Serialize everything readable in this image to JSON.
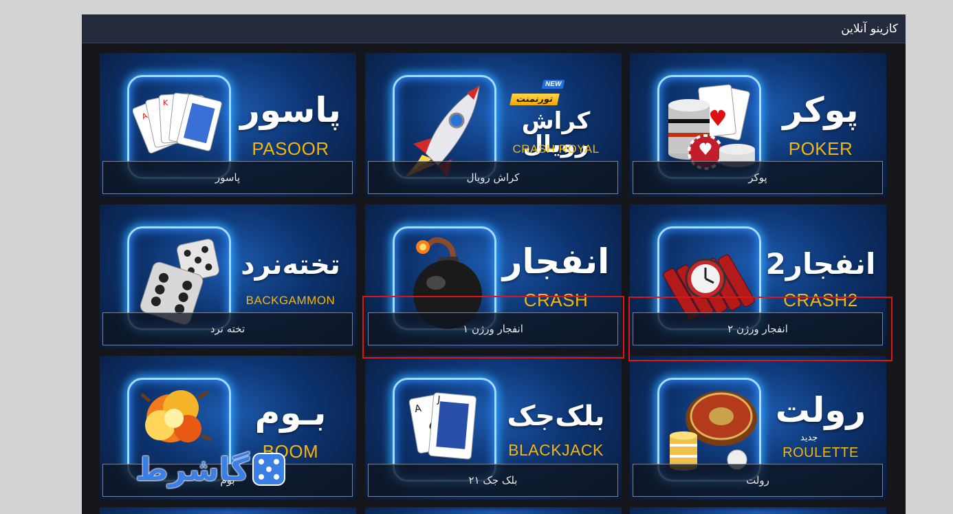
{
  "header": {
    "title": "کازینو آنلاین"
  },
  "games": [
    {
      "id": "pasoor",
      "title_fa": "پاسور",
      "title_en": "PASOOR",
      "caption": "پاسور",
      "icon": "playing-cards-fan-icon"
    },
    {
      "id": "crash-royal",
      "title_fa": "کراش رویال",
      "title_en": "CRASH ROYAL",
      "caption": "کراش رویال",
      "icon": "rocket-icon",
      "badge_new": "NEW",
      "badge_tournament": "تورنمنت"
    },
    {
      "id": "poker",
      "title_fa": "پوکر",
      "title_en": "POKER",
      "caption": "پوکر",
      "icon": "poker-chips-cards-icon"
    },
    {
      "id": "backgammon",
      "title_fa": "تخته‌نرد",
      "title_en": "BACKGAMMON",
      "caption": "تخته نرد",
      "icon": "dice-icon"
    },
    {
      "id": "crash1",
      "title_fa": "انفجار",
      "title_en": "CRASH",
      "caption": "انفجار ورژن ۱",
      "icon": "bomb-icon"
    },
    {
      "id": "crash2",
      "title_fa": "انفجار2",
      "title_en": "CRASH2",
      "caption": "انفجار ورژن ۲",
      "icon": "dynamite-clock-icon"
    },
    {
      "id": "boom",
      "title_fa": "بـوم",
      "title_en": "BOOM",
      "caption": "بوم",
      "icon": "explosion-icon"
    },
    {
      "id": "blackjack",
      "title_fa": "بلک‌جک",
      "title_en": "BLACKJACK",
      "caption": "بلک جک ۲۱",
      "icon": "blackjack-cards-icon"
    },
    {
      "id": "roulette",
      "title_fa": "رولت",
      "title_en": "ROULETTE",
      "caption": "رولت",
      "icon": "roulette-wheel-icon",
      "sub_fa": "جدید"
    }
  ],
  "watermark": {
    "text": "گاشرط"
  },
  "colors": {
    "accent_gold": "#f5b60a",
    "highlight_red": "#e01515",
    "header_bg": "#232a3c",
    "page_bg": "#d3d3d3"
  }
}
